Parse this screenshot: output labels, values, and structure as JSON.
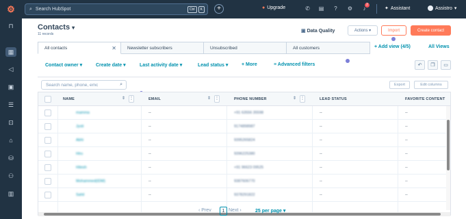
{
  "topbar": {
    "search_placeholder": "Search HubSpot",
    "kbd1": "Ctrl",
    "kbd2": "K",
    "upgrade": "Upgrade",
    "assistant": "Assistant",
    "account": "Assistro",
    "notif_count": "2"
  },
  "header": {
    "title": "Contacts",
    "records": "11 records",
    "data_quality": "Data Quality",
    "actions": "Actions",
    "import": "Import",
    "create": "Create contact"
  },
  "tabs": [
    {
      "label": "All contacts"
    },
    {
      "label": "Newsletter subscribers"
    },
    {
      "label": "Unsubscribed"
    },
    {
      "label": "All customers"
    }
  ],
  "add_view": "+ Add view (4/5)",
  "all_views": "All Views",
  "filters": {
    "owner": "Contact owner",
    "create_date": "Create date",
    "last_activity": "Last activity date",
    "lead_status": "Lead status",
    "more": "+ More",
    "advanced": "Advanced filters"
  },
  "table": {
    "search_placeholder": "Search name, phone, emc",
    "export": "Export",
    "edit_columns": "Edit columns",
    "columns": [
      "NAME",
      "EMAIL",
      "PHONE NUMBER",
      "LEAD STATUS",
      "FAVORITE CONTENT"
    ],
    "rows": [
      {
        "name": "mamma",
        "email": "--",
        "phone": "+91 63556 35598",
        "status": "--",
        "fav": "--"
      },
      {
        "name": "Jyoti",
        "email": "--",
        "phone": "9174898987",
        "status": "--",
        "fav": "--"
      },
      {
        "name": "Abhi",
        "email": "--",
        "phone": "9395265824",
        "status": "--",
        "fav": "--"
      },
      {
        "name": "Hiru",
        "email": "--",
        "phone": "9396225380",
        "status": "--",
        "fav": "--"
      },
      {
        "name": "Hitesh",
        "email": "--",
        "phone": "+91 96623 09525",
        "status": "--",
        "fav": "--"
      },
      {
        "name": "Mohammed(IDM)",
        "email": "--",
        "phone": "9387606770",
        "status": "--",
        "fav": "--"
      },
      {
        "name": "Sahil",
        "email": "--",
        "phone": "9378291822",
        "status": "--",
        "fav": "--"
      }
    ]
  },
  "pagination": {
    "prev": "Prev",
    "page": "1",
    "next": "Next",
    "per_page": "25 per page"
  }
}
